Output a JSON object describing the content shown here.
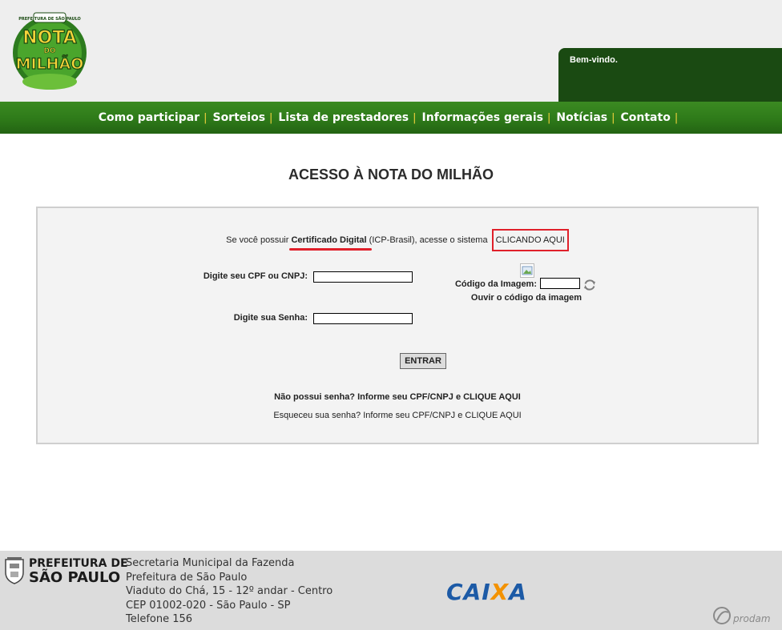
{
  "header": {
    "logo_text": [
      "NOTA",
      "DO",
      "MILHÃO"
    ],
    "logo_badge": "PREFEITURA DE SÃO PAULO",
    "welcome": "Bem-vindo."
  },
  "nav": {
    "items": [
      {
        "label": "Como participar"
      },
      {
        "label": "Sorteios"
      },
      {
        "label": "Lista de prestadores"
      },
      {
        "label": "Informações gerais"
      },
      {
        "label": "Notícias"
      },
      {
        "label": "Contato"
      }
    ],
    "separator": "|"
  },
  "page": {
    "title": "ACESSO À NOTA DO MILHÃO"
  },
  "login": {
    "cert_prefix": "Se você possuir ",
    "cert_strong": "Certificado Digital",
    "cert_middle": " (ICP-Brasil), acesse o sistema ",
    "cert_link": "CLICANDO AQUI",
    "cpf_label": "Digite seu CPF ou CNPJ:",
    "cpf_value": "",
    "password_label": "Digite sua Senha:",
    "password_value": "",
    "captcha_label": "Código da Imagem:",
    "captcha_value": "",
    "audio_link": "Ouvir o código da imagem",
    "enter_button": "ENTRAR",
    "no_password": "Não possui senha? Informe seu CPF/CNPJ e CLIQUE AQUI",
    "forgot_prefix": "Esqueceu sua senha? Informe seu CPF/CNPJ e  ",
    "forgot_link": "CLIQUE AQUI"
  },
  "footer": {
    "prefeitura_line1": "PREFEITURA DE",
    "prefeitura_line2": "SÃO PAULO",
    "address_lines": [
      "Secretaria Municipal da Fazenda",
      "Prefeitura de São Paulo",
      "Viaduto do Chá, 15 - 12º andar - Centro",
      "CEP 01002-020 - São Paulo - SP",
      "Telefone 156"
    ],
    "caixa_logo": "CAIXA",
    "prodam_logo": "prodam"
  },
  "colors": {
    "nav_green": "#2e7a19",
    "welcome_green": "#1a4a12",
    "separator_yellow": "#f3d23c",
    "highlight_red": "#e0202a",
    "caixa_blue": "#1c5aa6",
    "caixa_orange": "#f39200"
  },
  "icons": {
    "refresh": "refresh-icon",
    "captcha": "captcha-image-icon",
    "coat_of_arms": "coat-of-arms-icon"
  }
}
